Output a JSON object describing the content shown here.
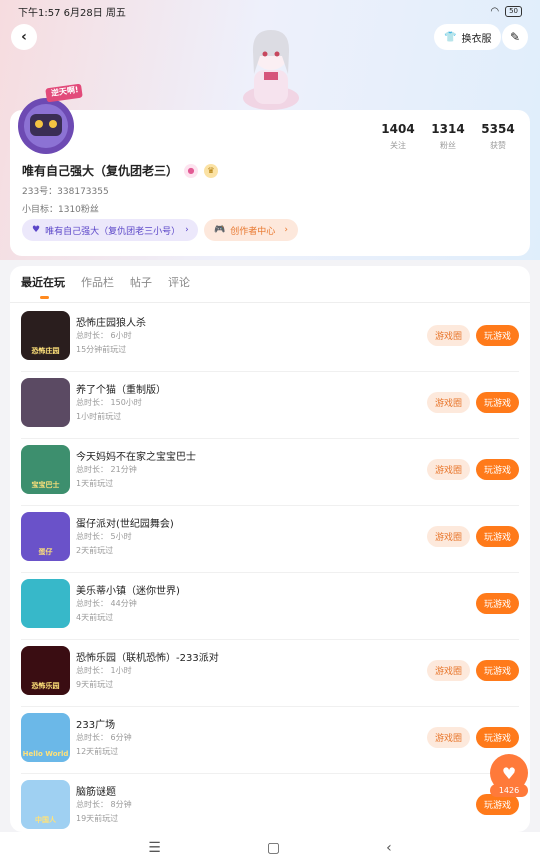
{
  "status": {
    "time_date": "下午1:57 6月28日 周五",
    "battery": "50"
  },
  "header": {
    "outfit_label": "换衣服"
  },
  "stats": [
    {
      "value": "1404",
      "label": "关注"
    },
    {
      "value": "1314",
      "label": "粉丝"
    },
    {
      "value": "5354",
      "label": "获赞"
    }
  ],
  "profile": {
    "badge_text": "逆天啊!",
    "name": "唯有自己强大（复仇团老三）",
    "id_text": "233号：338173355",
    "goal_text": "小目标：1310粉丝",
    "chip_secondary": "唯有自己强大（复仇团老三小号）",
    "chip_creator": "创作者中心"
  },
  "tabs": [
    "最近在玩",
    "作品栏",
    "帖子",
    "评论"
  ],
  "buttons": {
    "circle": "游戏圈",
    "play": "玩游戏"
  },
  "games": [
    {
      "title": "恐怖庄园狼人杀",
      "duration": "总时长： 6小时",
      "last_played": "15分钟前玩过",
      "has_circle": true,
      "icon_text": "恐怖庄园",
      "icon_bg": "#2a1e1e"
    },
    {
      "title": "养了个猫（重制版）",
      "duration": "总时长： 150小时",
      "last_played": "1小时前玩过",
      "has_circle": true,
      "icon_text": "",
      "icon_bg": "#5b4a63"
    },
    {
      "title": "今天妈妈不在家之宝宝巴士",
      "duration": "总时长： 21分钟",
      "last_played": "1天前玩过",
      "has_circle": true,
      "icon_text": "宝宝巴士",
      "icon_bg": "#3d8f6e"
    },
    {
      "title": "蛋仔派对(世纪园舞会)",
      "duration": "总时长： 5小时",
      "last_played": "2天前玩过",
      "has_circle": true,
      "icon_text": "蛋仔",
      "icon_bg": "#6a52c9"
    },
    {
      "title": "美乐蒂小镇（迷你世界)",
      "duration": "总时长： 44分钟",
      "last_played": "4天前玩过",
      "has_circle": false,
      "icon_text": "",
      "icon_bg": "#37b8c9"
    },
    {
      "title": "恐怖乐园（联机恐怖）-233派对",
      "duration": "总时长： 1小时",
      "last_played": "9天前玩过",
      "has_circle": true,
      "icon_text": "恐怖乐园",
      "icon_bg": "#3a0d12"
    },
    {
      "title": "233广场",
      "duration": "总时长： 6分钟",
      "last_played": "12天前玩过",
      "has_circle": true,
      "icon_text": "Hello World",
      "icon_bg": "#6bb8e8"
    },
    {
      "title": "脑筋谜题",
      "duration": "总时长： 8分钟",
      "last_played": "19天前玩过",
      "has_circle": false,
      "icon_text": "中国人",
      "icon_bg": "#9fd0f2"
    }
  ],
  "fab": {
    "count": "1426"
  }
}
